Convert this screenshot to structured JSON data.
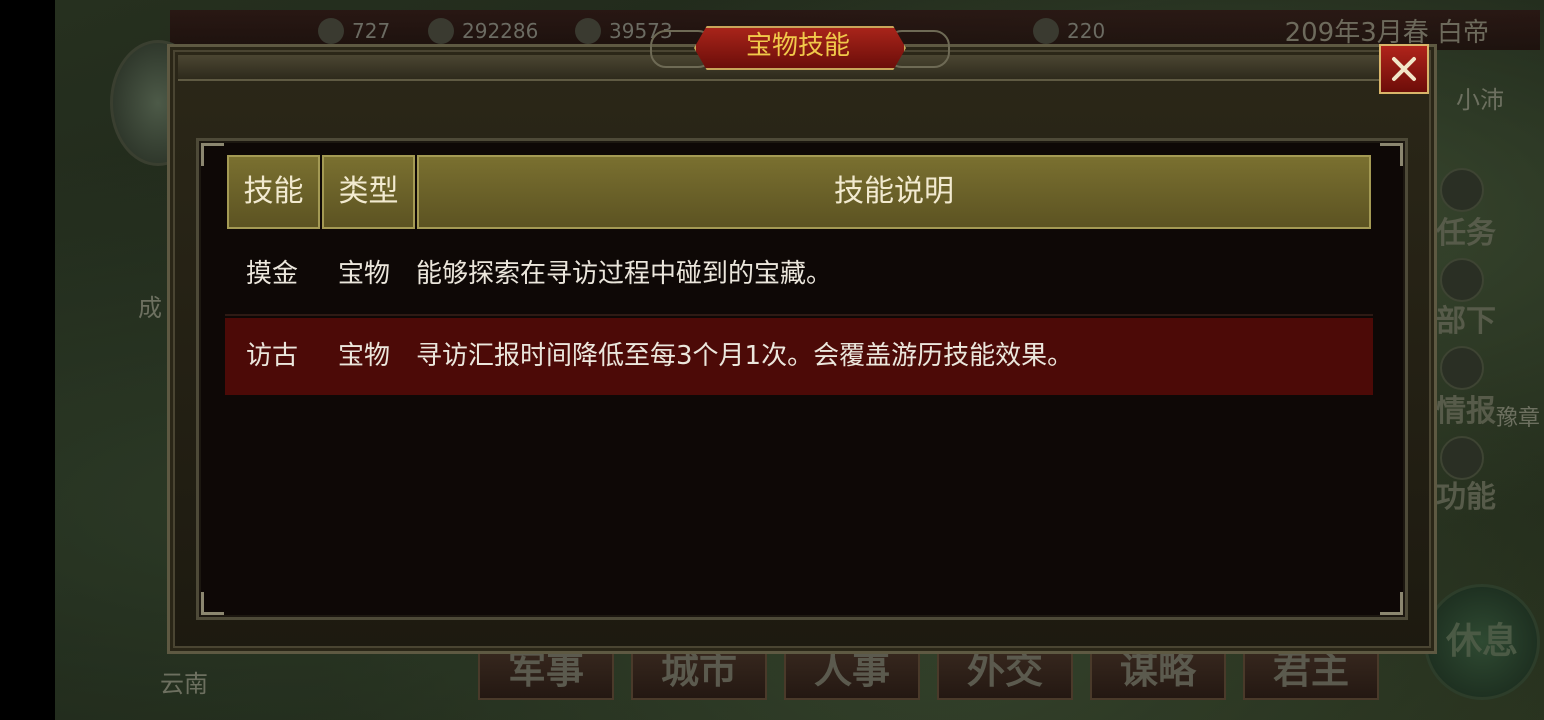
{
  "top_bar": {
    "resources": [
      {
        "icon": "troop-icon",
        "value": "727"
      },
      {
        "icon": "money-bag-icon",
        "value": "292286"
      },
      {
        "icon": "grain-icon",
        "value": "39573"
      },
      {
        "icon": "scroll-icon",
        "value": "220"
      }
    ],
    "date": "209年3月春 白帝"
  },
  "map_labels": {
    "xiaopei": "小沛",
    "cheng": "成",
    "yunnan": "云南",
    "yuzhang": "豫章"
  },
  "side_menu": [
    "任务",
    "部下",
    "情报",
    "功能"
  ],
  "bottom_tabs": [
    "军事",
    "城市",
    "人事",
    "外交",
    "谋略",
    "君主"
  ],
  "rest_button": "休息",
  "dialog": {
    "title": "宝物技能",
    "close_icon": "close-icon",
    "headers": {
      "skill": "技能",
      "type": "类型",
      "description": "技能说明"
    },
    "rows": [
      {
        "skill": "摸金",
        "type": "宝物",
        "description": "能够探索在寻访过程中碰到的宝藏。"
      },
      {
        "skill": "访古",
        "type": "宝物",
        "description": "寻访汇报时间降低至每3个月1次。会覆盖游历技能效果。"
      }
    ]
  },
  "colors": {
    "title_text": "#f1c94a",
    "header_bg": "#6b6129",
    "highlight_row": "#4c0a07",
    "close_bg": "#a0201a"
  }
}
